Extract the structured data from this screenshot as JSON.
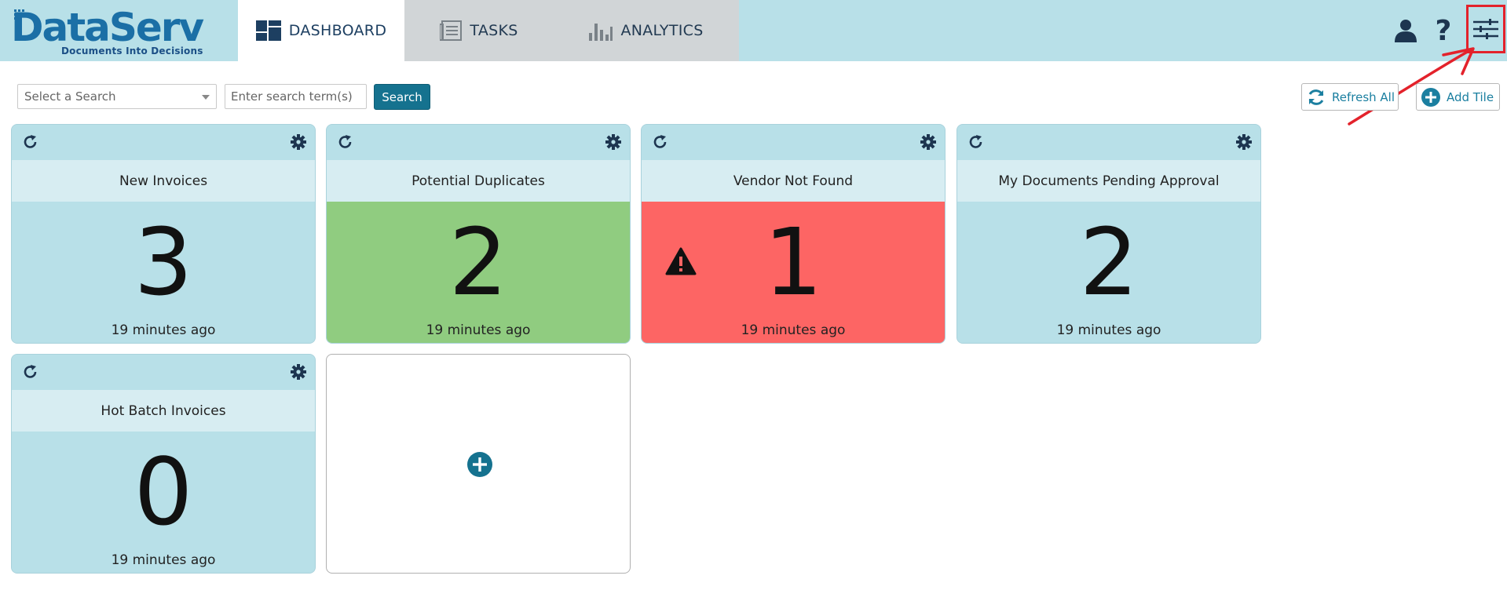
{
  "logo": {
    "word": "DataServ",
    "tm": "®",
    "tagline": "Documents Into Decisions"
  },
  "tabs": [
    {
      "label": "DASHBOARD",
      "icon": "dashboard-icon",
      "active": true
    },
    {
      "label": "TASKS",
      "icon": "tasks-icon",
      "active": false
    },
    {
      "label": "ANALYTICS",
      "icon": "analytics-icon",
      "active": false
    }
  ],
  "header_icons": {
    "user": "user-icon",
    "help": "?",
    "settings": "sliders-icon"
  },
  "search": {
    "select_placeholder": "Select a Search",
    "term_placeholder": "Enter search term(s)",
    "button_label": "Search"
  },
  "toolbar": {
    "refresh_all_label": "Refresh All",
    "add_tile_label": "Add Tile"
  },
  "tiles": [
    {
      "title": "New Invoices",
      "count": "3",
      "time": "19 minutes ago",
      "status": "normal"
    },
    {
      "title": "Potential Duplicates",
      "count": "2",
      "time": "19 minutes ago",
      "status": "good"
    },
    {
      "title": "Vendor Not Found",
      "count": "1",
      "time": "19 minutes ago",
      "status": "warning"
    },
    {
      "title": "My Documents Pending Approval",
      "count": "2",
      "time": "19 minutes ago",
      "status": "normal"
    },
    {
      "title": "Hot Batch Invoices",
      "count": "0",
      "time": "19 minutes ago",
      "status": "normal"
    }
  ],
  "colors": {
    "header_bg": "#b8e0e8",
    "accent": "#15728f",
    "tile_good": "#90cc80",
    "tile_warning": "#fd6564",
    "highlight": "#e3222b"
  }
}
